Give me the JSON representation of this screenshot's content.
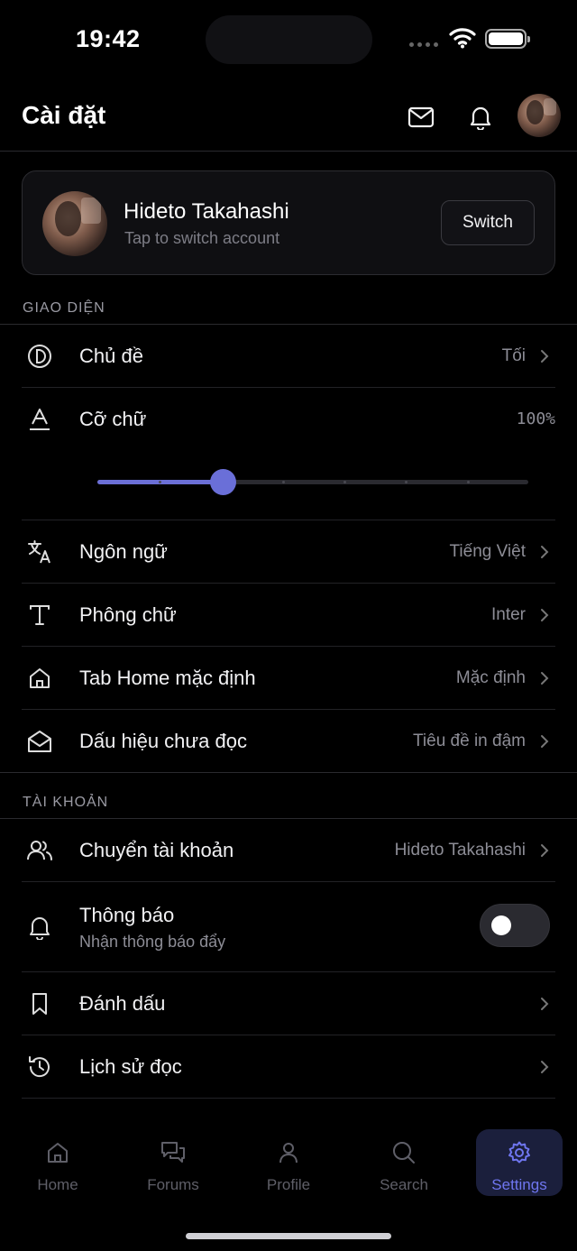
{
  "status": {
    "time": "19:42"
  },
  "header": {
    "title": "Cài đặt"
  },
  "account_card": {
    "name": "Hideto Takahashi",
    "subtitle": "Tap to switch account",
    "switch_label": "Switch"
  },
  "sections": {
    "appearance": {
      "label": "GIAO DIỆN",
      "rows": [
        {
          "label": "Chủ đề",
          "value": "Tối",
          "icon": "theme-icon"
        },
        {
          "label": "Cỡ chữ",
          "value": "100%",
          "icon": "font-size-icon"
        },
        {
          "label": "Ngôn ngữ",
          "value": "Tiếng Việt",
          "icon": "translate-icon"
        },
        {
          "label": "Phông chữ",
          "value": "Inter",
          "icon": "typeface-icon"
        },
        {
          "label": "Tab Home mặc định",
          "value": "Mặc định",
          "icon": "home-icon"
        },
        {
          "label": "Dấu hiệu chưa đọc",
          "value": "Tiêu đề in đậm",
          "icon": "envelope-open-icon"
        }
      ],
      "font_size_slider": {
        "value_fraction": 0.29,
        "steps": 8
      }
    },
    "account": {
      "label": "TÀI KHOẢN",
      "rows": [
        {
          "label": "Chuyển tài khoản",
          "value": "Hideto Takahashi",
          "icon": "users-icon"
        },
        {
          "label": "Thông báo",
          "sublabel": "Nhận thông báo đẩy",
          "toggle_on": false,
          "icon": "bell-icon"
        },
        {
          "label": "Đánh dấu",
          "icon": "bookmark-icon"
        },
        {
          "label": "Lịch sử đọc",
          "icon": "history-icon"
        }
      ]
    }
  },
  "tabbar": {
    "tabs": [
      {
        "label": "Home",
        "icon": "home-icon"
      },
      {
        "label": "Forums",
        "icon": "chat-bubbles-icon"
      },
      {
        "label": "Profile",
        "icon": "person-icon"
      },
      {
        "label": "Search",
        "icon": "search-icon"
      },
      {
        "label": "Settings",
        "icon": "gear-icon"
      }
    ],
    "active_index": 4
  },
  "colors": {
    "accent": "#6b6fd6",
    "background": "#000000",
    "card": "#0f0f12"
  }
}
